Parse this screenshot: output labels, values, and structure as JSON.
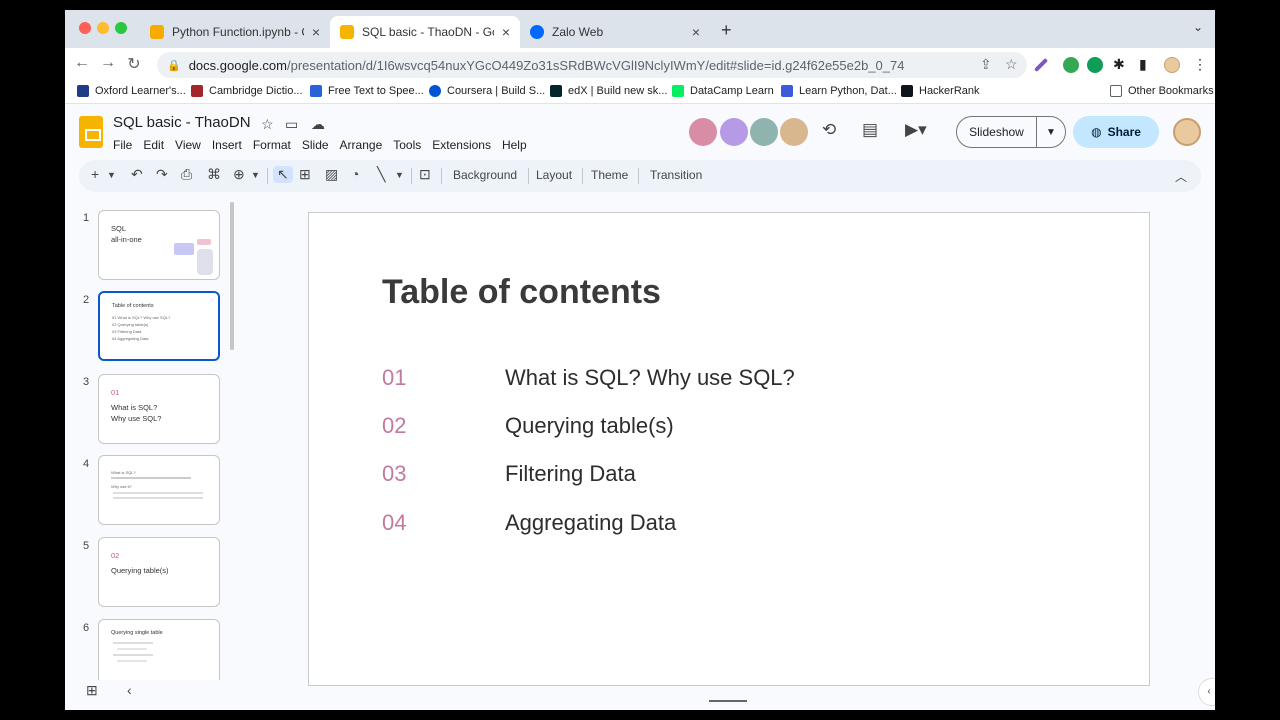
{
  "browser": {
    "tabs": [
      {
        "title": "Python Function.ipynb - Colab",
        "favicon_color": "#f9ab00"
      },
      {
        "title": "SQL basic - ThaoDN - Google",
        "favicon_color": "#f6b400"
      },
      {
        "title": "Zalo Web",
        "favicon_color": "#0068ff"
      }
    ],
    "url_host": "docs.google.com",
    "url_path": "/presentation/d/1I6wsvcq54nuxYGcO449Zo31sSRdBWcVGlI9NclyIWmY/edit#slide=id.g24f62e55e2b_0_74",
    "bookmarks": [
      {
        "label": "Oxford Learner's...",
        "color": "#1f3c88"
      },
      {
        "label": "Cambridge Dictio...",
        "color": "#a3262a"
      },
      {
        "label": "Free Text to Spee...",
        "color": "#2a61d6"
      },
      {
        "label": "Coursera | Build S...",
        "color": "#0056d2"
      },
      {
        "label": "edX | Build new sk...",
        "color": "#02262b"
      },
      {
        "label": "DataCamp Learn",
        "color": "#03ef62"
      },
      {
        "label": "Learn Python, Dat...",
        "color": "#3b5bdb"
      },
      {
        "label": "HackerRank",
        "color": "#0e141e"
      }
    ],
    "other_bookmarks": "Other Bookmarks"
  },
  "app": {
    "doc_title": "SQL basic - ThaoDN",
    "menu": [
      "File",
      "Edit",
      "View",
      "Insert",
      "Format",
      "Slide",
      "Arrange",
      "Tools",
      "Extensions",
      "Help"
    ],
    "collaborator_colors": [
      "#d88ca6",
      "#b69ae6",
      "#8fb4b0",
      "#d9b78e"
    ],
    "slideshow_label": "Slideshow",
    "share_label": "Share",
    "toolbar": {
      "background": "Background",
      "layout": "Layout",
      "theme": "Theme",
      "transition": "Transition"
    }
  },
  "filmstrip": [
    {
      "num": "1",
      "line1": "SQL",
      "line2": "all-in-one"
    },
    {
      "num": "2",
      "title": "Table of contents",
      "items": [
        "01    What is SQL? Why use SQL?",
        "02    Querying table(s)",
        "03    Filtering Data",
        "04    Aggregating Data"
      ]
    },
    {
      "num": "3",
      "sub": "01",
      "line1": "What is SQL?",
      "line2": "Why use SQL?"
    },
    {
      "num": "4",
      "line1": "What is SQL?",
      "line2": "Why use it?"
    },
    {
      "num": "5",
      "sub": "02",
      "line1": "Querying table(s)"
    },
    {
      "num": "6",
      "line1": "Querying single table"
    }
  ],
  "slide": {
    "title": "Table of contents",
    "items": [
      {
        "num": "01",
        "text": "What is SQL? Why use SQL?"
      },
      {
        "num": "02",
        "text": "Querying table(s)"
      },
      {
        "num": "03",
        "text": "Filtering Data"
      },
      {
        "num": "04",
        "text": "Aggregating Data"
      }
    ]
  }
}
